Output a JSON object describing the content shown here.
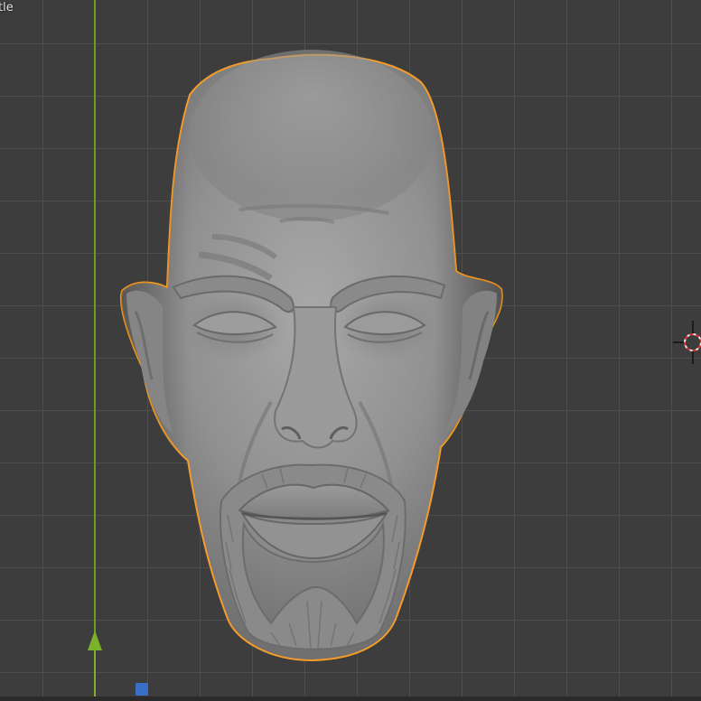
{
  "viewport": {
    "label": "tle"
  },
  "colors": {
    "background": "#3d3d3d",
    "grid_line": "#505050",
    "y_axis": "#6ca022",
    "selection_outline": "#f39c2b",
    "gizmo_x": "#3a6fc7",
    "model_base": "#8f8f8f"
  },
  "objects": {
    "head_model": "selected-sculpted-head",
    "cursor": "3d-cursor-icon"
  }
}
